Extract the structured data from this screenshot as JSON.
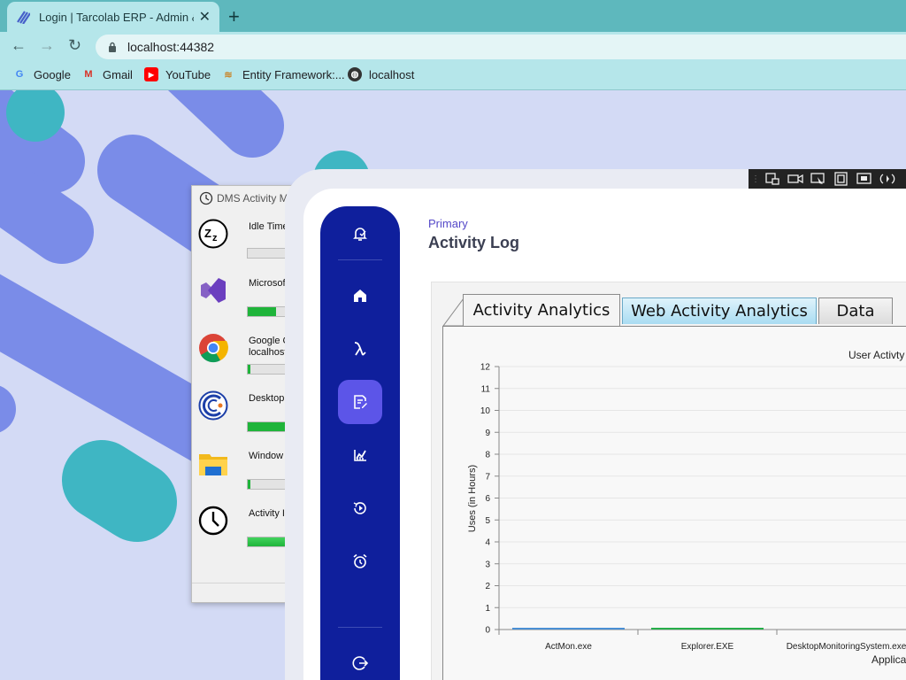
{
  "browser": {
    "tab_title": "Login | Tarcolab ERP - Admin & D",
    "url": "localhost:44382",
    "bookmarks": [
      "Google",
      "Gmail",
      "YouTube",
      "Entity Framework:...",
      "localhost"
    ]
  },
  "dms_window": {
    "title": "DMS Activity M",
    "rows": [
      {
        "label": "Idle Time",
        "label2": "",
        "icon": "sleep-zz-icon",
        "progress": 0
      },
      {
        "label": "Microsof",
        "label2": "",
        "icon": "visual-studio-icon",
        "progress": 0.55
      },
      {
        "label": "Google C",
        "label2": "localhost",
        "icon": "chrome-icon",
        "progress": 0.05
      },
      {
        "label": "Desktop",
        "label2": "",
        "icon": "desktop-monitor-app-icon",
        "progress": 1.0
      },
      {
        "label": "Window",
        "label2": "",
        "icon": "file-explorer-icon",
        "progress": 0.06
      },
      {
        "label": "Activity I",
        "label2": "",
        "icon": "clock-icon",
        "progress": 1.0
      }
    ]
  },
  "sidebar": {
    "items": [
      {
        "name": "bell-check-icon",
        "active": false
      },
      {
        "name": "home-icon",
        "active": false
      },
      {
        "name": "lambda-icon",
        "active": false
      },
      {
        "name": "edit-document-icon",
        "active": true
      },
      {
        "name": "chart-trend-icon",
        "active": false
      },
      {
        "name": "play-history-icon",
        "active": false
      },
      {
        "name": "alarm-clock-icon",
        "active": false
      },
      {
        "name": "logout-icon",
        "active": false
      }
    ]
  },
  "header": {
    "breadcrumb": "Primary",
    "title": "Activity Log"
  },
  "tabs": [
    "Activity Analytics",
    "Web Activity Analytics",
    "Data"
  ],
  "colors": {
    "sidebar": "#0f1f9c",
    "sidebar_active": "#5c55e8",
    "accent": "#5448c8",
    "series1": "#4a8fd4",
    "series2": "#27ae4a"
  },
  "chart_data": {
    "type": "bar",
    "title": "User Activty",
    "xlabel": "Applica",
    "ylabel": "Uses (in Hours)",
    "ylim": [
      0,
      12
    ],
    "yticks": [
      0,
      1,
      2,
      3,
      4,
      5,
      6,
      7,
      8,
      9,
      10,
      11,
      12
    ],
    "categories": [
      "ActMon.exe",
      "Explorer.EXE",
      "DesktopMonitoringSystem.exe"
    ],
    "values": [
      0.04,
      0.06,
      0
    ],
    "grid": true
  }
}
